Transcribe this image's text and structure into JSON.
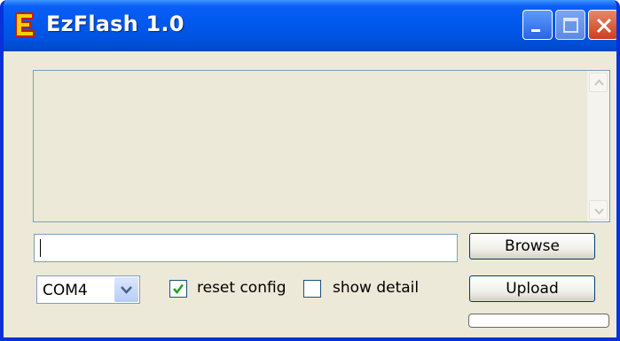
{
  "window": {
    "title": "EzFlash 1.0",
    "app_icon": "ezflash-e-icon",
    "controls": [
      "minimize-icon",
      "maximize-icon",
      "close-icon"
    ]
  },
  "log": {
    "text": ""
  },
  "file_path": {
    "value": ""
  },
  "buttons": {
    "browse": "Browse",
    "upload": "Upload"
  },
  "port": {
    "selected": "COM4"
  },
  "options": {
    "reset_config": {
      "label": "reset config",
      "checked": true
    },
    "show_detail": {
      "label": "show detail",
      "checked": false
    }
  },
  "progress": {
    "value": 0
  },
  "colors": {
    "titlebar": "#0058ee",
    "window_bg": "#ece9d8",
    "check_mark": "#21a121",
    "close_button": "#d5532f"
  }
}
